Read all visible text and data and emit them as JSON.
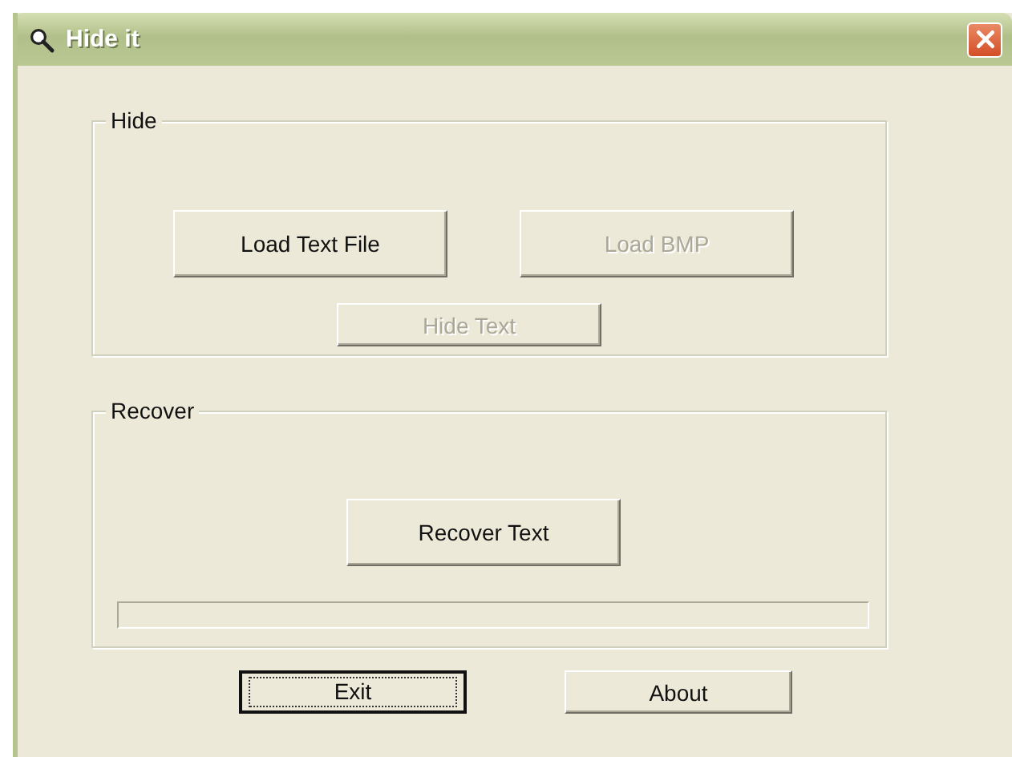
{
  "window": {
    "title": "Hide it"
  },
  "hide_group": {
    "label": "Hide",
    "buttons": [
      {
        "label": "Load Text File",
        "disabled": false
      },
      {
        "label": "Load BMP",
        "disabled": true
      },
      {
        "label": "Hide Text",
        "disabled": true
      }
    ]
  },
  "recover_group": {
    "label": "Recover",
    "button": {
      "label": "Recover Text",
      "disabled": false
    },
    "progress": {
      "level": 0
    }
  },
  "buttons": [
    {
      "label": "Exit",
      "focused": true
    },
    {
      "label": "About",
      "focused": false
    }
  ]
}
